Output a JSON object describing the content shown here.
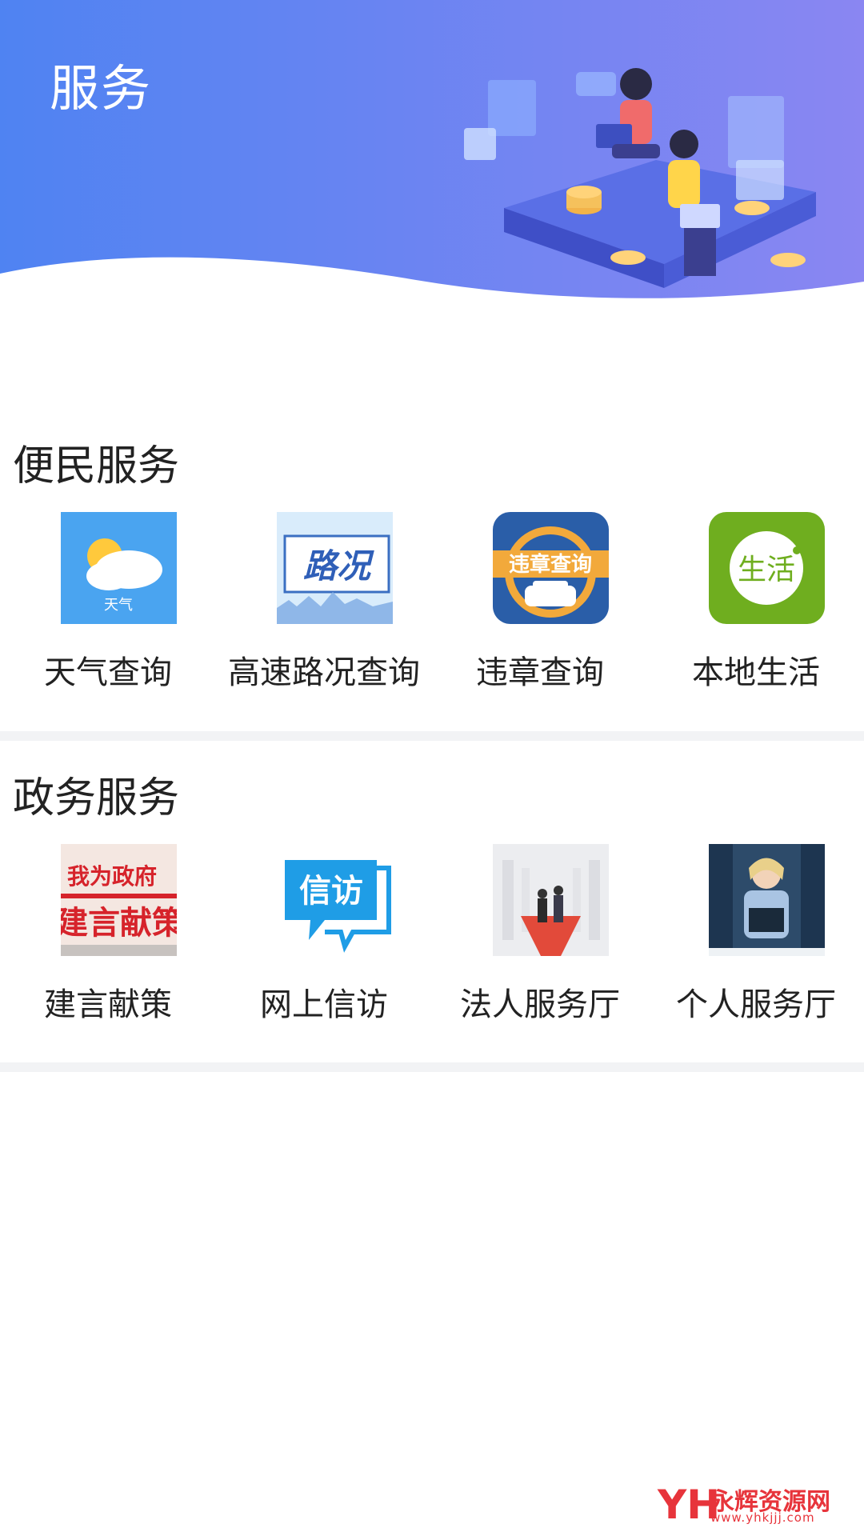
{
  "header": {
    "title": "服务",
    "gradient_start": "#4f83f2",
    "gradient_end": "#8a86f2"
  },
  "sections": [
    {
      "title": "便民服务",
      "items": [
        {
          "label": "天气查询",
          "icon": "weather-icon",
          "icon_text": "天气"
        },
        {
          "label": "高速路况查询",
          "icon": "road-condition-icon",
          "icon_text": "路况"
        },
        {
          "label": "违章查询",
          "icon": "traffic-violation-icon",
          "icon_text": "违章查询"
        },
        {
          "label": "本地生活",
          "icon": "local-life-icon",
          "icon_text": "生活"
        }
      ]
    },
    {
      "title": "政务服务",
      "items": [
        {
          "label": "建言献策",
          "icon": "suggestion-icon",
          "icon_text_top": "我为政府",
          "icon_text_bottom": "建言献策"
        },
        {
          "label": "网上信访",
          "icon": "petition-icon",
          "icon_text": "信访"
        },
        {
          "label": "法人服务厅",
          "icon": "legal-person-hall-icon"
        },
        {
          "label": "个人服务厅",
          "icon": "personal-hall-icon"
        }
      ]
    }
  ],
  "watermark": {
    "mark": "YH",
    "text": "永辉资源网",
    "url": "www.yhkjjj.com"
  }
}
